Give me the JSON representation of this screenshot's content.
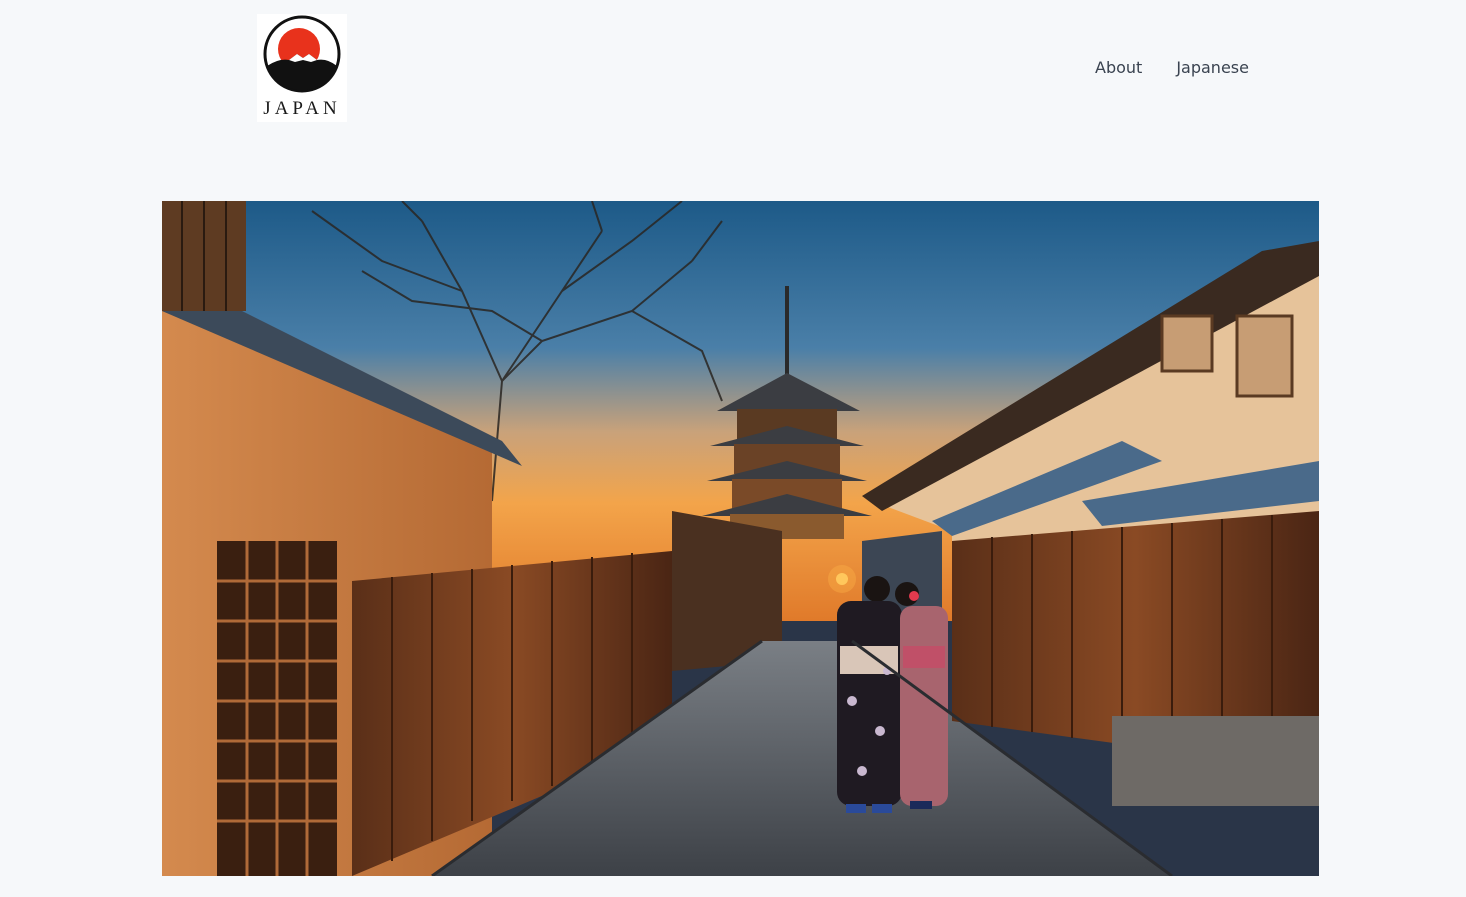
{
  "site": {
    "logo_text": "JAPAN"
  },
  "nav": {
    "items": [
      {
        "label": "About"
      },
      {
        "label": "Japanese"
      }
    ]
  },
  "hero": {
    "scene": "pagoda-street-photo"
  },
  "colors": {
    "page_bg": "#f6f8fa",
    "logo_sun": "#e8321c",
    "nav_text": "#3a4350"
  }
}
